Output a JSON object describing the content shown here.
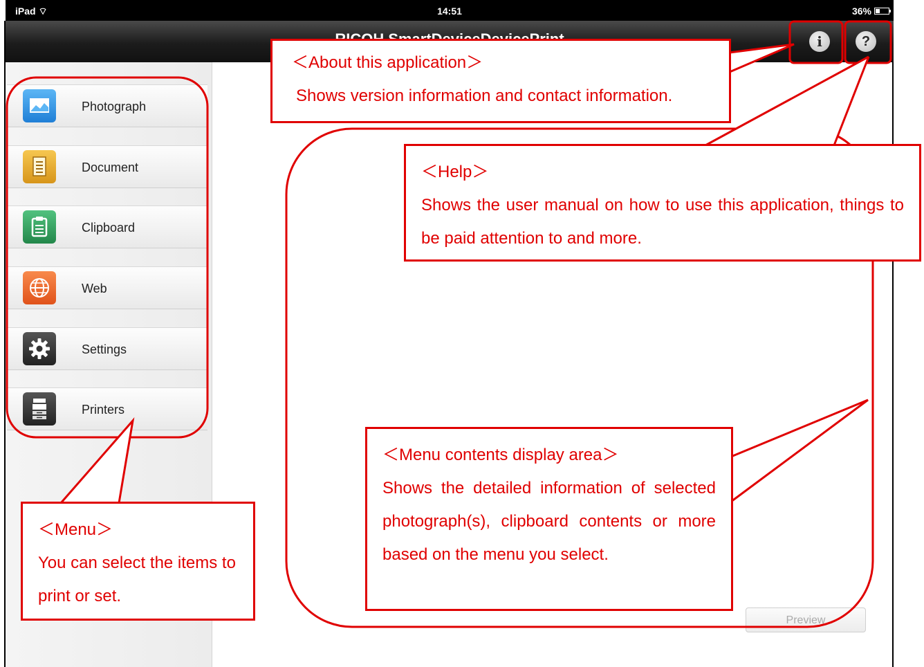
{
  "status_bar": {
    "carrier": "iPad",
    "time": "14:51",
    "battery": "36%",
    "battery_level": 0.36
  },
  "nav": {
    "title": "RICOH SmartDeviceDevicePrint"
  },
  "menu": {
    "items": [
      {
        "label": "Photograph",
        "icon": "photograph-icon",
        "color": "#2e8fe0"
      },
      {
        "label": "Document",
        "icon": "document-icon",
        "color": "#e0a21c"
      },
      {
        "label": "Clipboard",
        "icon": "clipboard-icon",
        "color": "#2f9a5a"
      },
      {
        "label": "Web",
        "icon": "web-globe-icon",
        "color": "#ee6422"
      },
      {
        "label": "Settings",
        "icon": "gear-icon",
        "color": "#3a3a3a"
      },
      {
        "label": "Printers",
        "icon": "printer-icon",
        "color": "#3a3a3a"
      }
    ]
  },
  "preview_button": {
    "label": "Preview"
  },
  "callouts": {
    "about": {
      "title": "＜About this application＞",
      "text": "Shows version information and contact information."
    },
    "help": {
      "title": "＜Help＞",
      "text": "Shows the user manual on how to use this application, things to be paid attention to and more."
    },
    "menu_contents": {
      "title": "＜Menu contents display area＞",
      "text": "Shows the detailed information of selected photograph(s), clipboard contents or more based on the menu you select."
    },
    "menu": {
      "title": "＜Menu＞",
      "text": "You can select the items to print or set."
    }
  },
  "colors": {
    "annotation_red": "#e00000",
    "nav_bar": "#1c1c1c"
  }
}
